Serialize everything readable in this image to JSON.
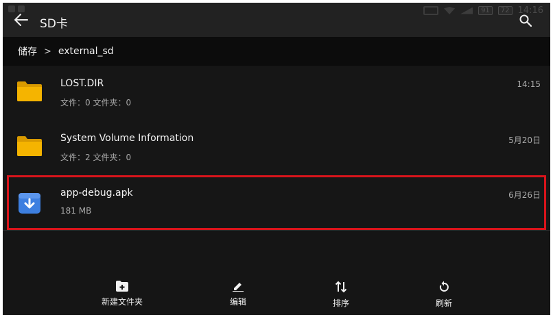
{
  "status_bar": {
    "battery_1": "91",
    "battery_2": "72",
    "time": "14:16"
  },
  "app_bar": {
    "title": "SD卡"
  },
  "breadcrumb": {
    "root": "储存",
    "separator": ">",
    "current": "external_sd"
  },
  "files": [
    {
      "name": "LOST.DIR",
      "meta": "文件：0  文件夹：0",
      "date": "14:15",
      "icon": "folder-icon"
    },
    {
      "name": "System Volume Information",
      "meta": "文件：2  文件夹：0",
      "date": "5月20日",
      "icon": "folder-icon"
    },
    {
      "name": "app-debug.apk",
      "meta": "181 MB",
      "date": "6月26日",
      "icon": "apk-download-icon"
    }
  ],
  "actions": [
    {
      "label": "新建文件夹",
      "icon": "new-folder-icon"
    },
    {
      "label": "编辑",
      "icon": "edit-icon"
    },
    {
      "label": "排序",
      "icon": "sort-icon"
    },
    {
      "label": "刷新",
      "icon": "refresh-icon"
    }
  ],
  "colors": {
    "background": "#151515",
    "folder": "#f5b400",
    "apk": "#3d7fe0",
    "highlight": "#d9141b"
  }
}
